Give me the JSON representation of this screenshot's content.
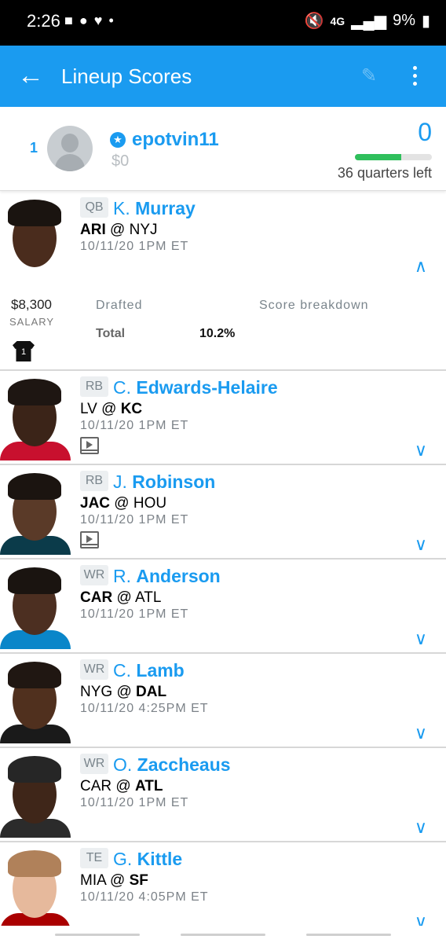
{
  "status": {
    "time": "2:26",
    "left_icons": [
      "message-icon",
      "reddit-icon",
      "heart-icon",
      "dot-icon"
    ],
    "network": "4G",
    "battery": "9%"
  },
  "appbar": {
    "title": "Lineup Scores"
  },
  "summary": {
    "rank": "1",
    "username": "epotvin11",
    "winnings": "$0",
    "score": "0",
    "progress": 0.6,
    "quarters_left": "36 quarters left"
  },
  "players": [
    {
      "pos": "QB",
      "first": "K.",
      "last": "Murray",
      "away": "ARI",
      "home": "NYJ",
      "bold": "away",
      "time": "10/11/20 1PM ET",
      "video": false,
      "expanded": true
    },
    {
      "pos": "RB",
      "first": "C.",
      "last": "Edwards-Helaire",
      "away": "LV",
      "home": "KC",
      "bold": "home",
      "time": "10/11/20 1PM ET",
      "video": true,
      "expanded": false
    },
    {
      "pos": "RB",
      "first": "J.",
      "last": "Robinson",
      "away": "JAC",
      "home": "HOU",
      "bold": "away",
      "time": "10/11/20 1PM ET",
      "video": true,
      "expanded": false
    },
    {
      "pos": "WR",
      "first": "R.",
      "last": "Anderson",
      "away": "CAR",
      "home": "ATL",
      "bold": "away",
      "time": "10/11/20 1PM ET",
      "video": false,
      "expanded": false
    },
    {
      "pos": "WR",
      "first": "C.",
      "last": "Lamb",
      "away": "NYG",
      "home": "DAL",
      "bold": "home",
      "time": "10/11/20 4:25PM ET",
      "video": false,
      "expanded": false
    },
    {
      "pos": "WR",
      "first": "O.",
      "last": "Zaccheaus",
      "away": "CAR",
      "home": "ATL",
      "bold": "home",
      "time": "10/11/20 1PM ET",
      "video": false,
      "expanded": false
    },
    {
      "pos": "TE",
      "first": "G.",
      "last": "Kittle",
      "away": "MIA",
      "home": "SF",
      "bold": "home",
      "time": "10/11/20 4:05PM ET",
      "video": false,
      "expanded": false
    }
  ],
  "expanded_detail": {
    "salary": "$8,300",
    "salary_label": "SALARY",
    "jersey": "1",
    "drafted_label": "Drafted",
    "total_label": "Total",
    "drafted_pct": "10.2%",
    "breakdown_label": "Score breakdown"
  },
  "colors": {
    "accent": "#1a9bf0",
    "progress": "#2fbf5c"
  }
}
